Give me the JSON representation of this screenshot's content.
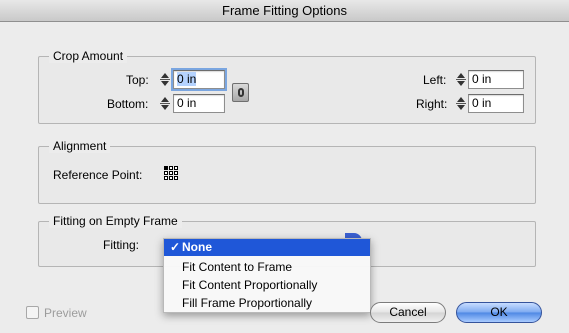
{
  "window": {
    "title": "Frame Fitting Options"
  },
  "crop_amount": {
    "legend": "Crop Amount",
    "top": {
      "label": "Top:",
      "value": "0 in"
    },
    "bottom": {
      "label": "Bottom:",
      "value": "0 in"
    },
    "left": {
      "label": "Left:",
      "value": "0 in"
    },
    "right": {
      "label": "Right:",
      "value": "0 in"
    }
  },
  "alignment": {
    "legend": "Alignment",
    "reference_point_label": "Reference Point:",
    "selected_point": "top-left"
  },
  "fitting_empty": {
    "legend": "Fitting on Empty Frame",
    "fitting_label": "Fitting:",
    "options": [
      {
        "label": "None",
        "selected": true,
        "check": "✓"
      },
      {
        "label": "Fit Content to Frame",
        "selected": false
      },
      {
        "label": "Fit Content Proportionally",
        "selected": false
      },
      {
        "label": "Fill Frame Proportionally",
        "selected": false
      }
    ]
  },
  "footer": {
    "preview_label": "Preview",
    "preview_checked": false,
    "cancel_label": "Cancel",
    "ok_label": "OK"
  },
  "colors": {
    "accent": "#1f57d8",
    "selection": "#b5d3ff"
  }
}
